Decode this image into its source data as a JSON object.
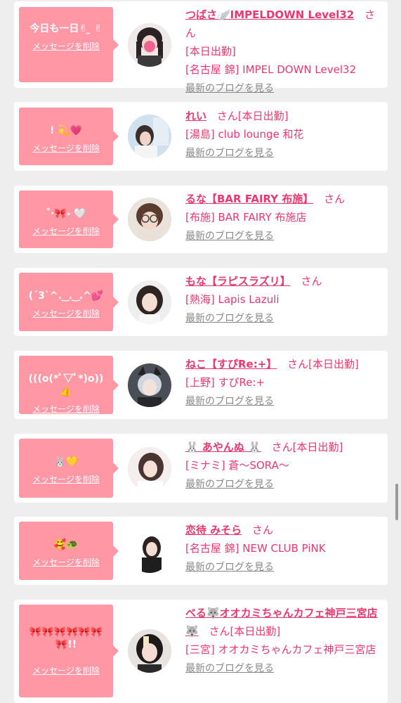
{
  "delete_label": "メッセージを削除",
  "blog_label": "最新のブログを見る",
  "san_label": "さん",
  "colors": {
    "accent": "#e8386d",
    "bubble": "#ff97a5",
    "background": "#eeeeee",
    "card": "#ffffff"
  },
  "items": [
    {
      "message": "今日も一日✌︎ ̫ ✌︎",
      "name": "つばさ🪽IMPELDOWN Level32",
      "status": "",
      "lines": [
        "[本日出勤]",
        "[名古屋 錦] IMPEL DOWN Level32"
      ]
    },
    {
      "message": "! 💫💗",
      "name": "れい",
      "status": "[本日出勤]",
      "lines": [
        "[湯島] club lounge 和花"
      ]
    },
    {
      "message": "˚‧🎀˖ 🤍",
      "name": "るな【BAR FAIRY 布施】",
      "status": "",
      "lines": [
        "[布施] BAR FAIRY 布施店"
      ]
    },
    {
      "message": "(ˊ3ˋ^. ͜ . ͜ .^💕",
      "name": "もな【ラピスラズリ】",
      "status": "",
      "lines": [
        "[熱海] Lapis Lazuli"
      ]
    },
    {
      "message": "(((o(*ﾟ▽ﾟ*)o))👍",
      "name": "ねこ【すぴRe:+】",
      "status": "[本日出勤]",
      "lines": [
        "[上野] すぴRe:+"
      ]
    },
    {
      "message": "🐰💛",
      "name": "🐰 あやんぬ 🐰",
      "status": "[本日出勤]",
      "lines": [
        "[ミナミ] 蒼〜SORA〜"
      ]
    },
    {
      "message": "🥰🐢",
      "name": "恋待 みそら",
      "status": "",
      "lines": [
        "[名古屋 錦] NEW CLUB PiNK"
      ]
    },
    {
      "message": "🎀🎀🎀🎀🎀🎀🎀!!",
      "name": "べる🐺オオカミちゃんカフェ神戸三宮店🐺",
      "status": "[本日出勤]",
      "lines": [
        "[三宮] オオカミちゃんカフェ神戸三宮店"
      ]
    }
  ]
}
